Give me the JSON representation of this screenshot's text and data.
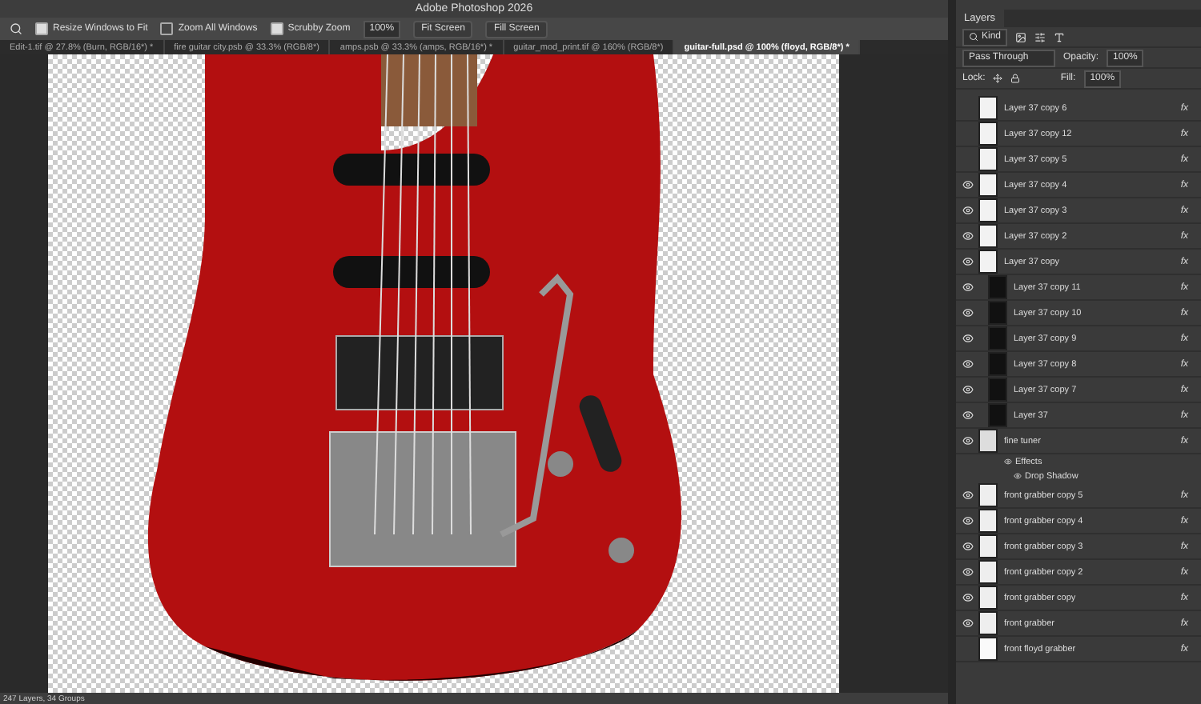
{
  "window": {
    "title": "Adobe Photoshop 2026"
  },
  "options_bar": {
    "options": [
      {
        "label": "Resize Windows to Fit",
        "checked": true
      },
      {
        "label": "Zoom All Windows",
        "checked": false
      },
      {
        "label": "Scrubby Zoom",
        "checked": true
      }
    ],
    "zoom": "100%",
    "buttons": [
      "Fit Screen",
      "Fill Screen"
    ]
  },
  "tabs": [
    {
      "label": "Edit-1.tif @ 27.8% (Burn, RGB/16*) *",
      "selected": false
    },
    {
      "label": "fire guitar city.psb @ 33.3% (RGB/8*)",
      "selected": false
    },
    {
      "label": "amps.psb @ 33.3% (amps, RGB/16*) *",
      "selected": false
    },
    {
      "label": "guitar_mod_print.tif @ 160% (RGB/8*)",
      "selected": false
    },
    {
      "label": "guitar-full.psd @ 100% (floyd, RGB/8*) *",
      "selected": true
    }
  ],
  "layers_panel": {
    "title": "Layers",
    "filter": "Kind",
    "blend_mode": "Pass Through",
    "opacity_label": "Opacity:",
    "opacity": "100%",
    "lock_label": "Lock:",
    "fill_label": "Fill:",
    "fill": "100%",
    "layers": [
      {
        "name": "Layer 37 copy 6",
        "kind": "figure",
        "visible": false,
        "fx": "fx"
      },
      {
        "name": "Layer 37 copy 12",
        "kind": "figure",
        "visible": false,
        "fx": "fx"
      },
      {
        "name": "Layer 37 copy 5",
        "kind": "figure",
        "visible": false,
        "fx": "fx"
      },
      {
        "name": "Layer 37 copy 4",
        "kind": "figure",
        "visible": true,
        "fx": "fx"
      },
      {
        "name": "Layer 37 copy 3",
        "kind": "figure",
        "visible": true,
        "fx": "fx"
      },
      {
        "name": "Layer 37 copy 2",
        "kind": "figure",
        "visible": true,
        "fx": "fx"
      },
      {
        "name": "Layer 37 copy",
        "kind": "figure",
        "visible": true,
        "fx": "fx"
      },
      {
        "name": "Layer 37 copy 11",
        "kind": "dark",
        "visible": true,
        "fx": "fx"
      },
      {
        "name": "Layer 37 copy 10",
        "kind": "dark",
        "visible": true,
        "fx": "fx"
      },
      {
        "name": "Layer 37 copy 9",
        "kind": "dark",
        "visible": true,
        "fx": "fx"
      },
      {
        "name": "Layer 37 copy 8",
        "kind": "dark",
        "visible": true,
        "fx": "fx"
      },
      {
        "name": "Layer 37 copy 7",
        "kind": "dark",
        "visible": true,
        "fx": "fx"
      },
      {
        "name": "Layer 37",
        "kind": "dark",
        "visible": true,
        "fx": "fx"
      },
      {
        "name": "fine tuner",
        "kind": "tuner",
        "visible": true,
        "fx": "fx",
        "effects": [
          "Effects",
          "Drop Shadow"
        ]
      },
      {
        "name": "front grabber copy 5",
        "kind": "grabber",
        "visible": true,
        "fx": "fx"
      },
      {
        "name": "front grabber copy 4",
        "kind": "grabber",
        "visible": true,
        "fx": "fx"
      },
      {
        "name": "front grabber copy 3",
        "kind": "grabber",
        "visible": true,
        "fx": "fx"
      },
      {
        "name": "front grabber copy 2",
        "kind": "grabber",
        "visible": true,
        "fx": "fx"
      },
      {
        "name": "front grabber copy",
        "kind": "grabber",
        "visible": true,
        "fx": "fx"
      },
      {
        "name": "front grabber",
        "kind": "grabber",
        "visible": true,
        "fx": "fx"
      },
      {
        "name": "front floyd grabber",
        "kind": "blank",
        "visible": false,
        "fx": "fx"
      }
    ]
  },
  "status_bar": {
    "text": "247 Layers, 34 Groups"
  }
}
